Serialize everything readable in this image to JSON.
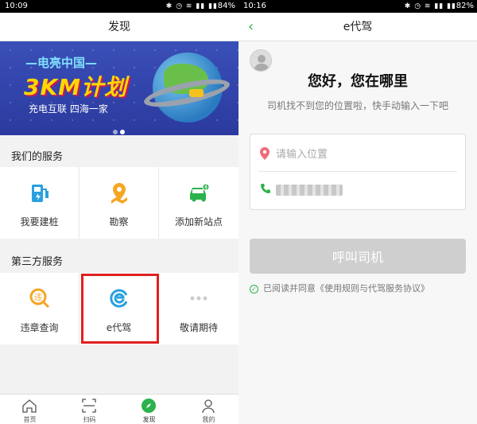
{
  "left": {
    "status": {
      "time": "10:09",
      "battery": "84%"
    },
    "title": "发现",
    "banner": {
      "top_text": "—电亮中国—",
      "big_text": "3KM计划",
      "sub_text": "充电互联   四海一家"
    },
    "our_services": {
      "title": "我们的服务",
      "items": [
        {
          "label": "我要建桩",
          "icon": "charging-station-icon"
        },
        {
          "label": "勘察",
          "icon": "map-pin-icon"
        },
        {
          "label": "添加新站点",
          "icon": "car-add-icon"
        }
      ]
    },
    "third_services": {
      "title": "第三方服务",
      "items": [
        {
          "label": "违章查询",
          "icon": "violation-search-icon"
        },
        {
          "label": "e代驾",
          "icon": "e-daijia-icon"
        },
        {
          "label": "敬请期待",
          "icon": "more-dots-icon"
        }
      ]
    },
    "tabs": [
      {
        "label": "首页",
        "icon": "home-icon"
      },
      {
        "label": "扫码",
        "icon": "scan-icon"
      },
      {
        "label": "发现",
        "icon": "compass-icon"
      },
      {
        "label": "我的",
        "icon": "profile-icon"
      }
    ]
  },
  "right": {
    "status": {
      "time": "10:16",
      "battery": "82%"
    },
    "title": "e代驾",
    "greeting": "您好，您在哪里",
    "hint": "司机找不到您的位置啦，快手动输入一下吧",
    "location_placeholder": "请输入位置",
    "call_button": "呼叫司机",
    "agreement": "已阅读并同意《使用规则与代驾服务协议》"
  },
  "colors": {
    "accent": "#2bb24c",
    "highlight": "#e02020",
    "icon_blue": "#29a0e0",
    "icon_orange": "#f5a623"
  }
}
